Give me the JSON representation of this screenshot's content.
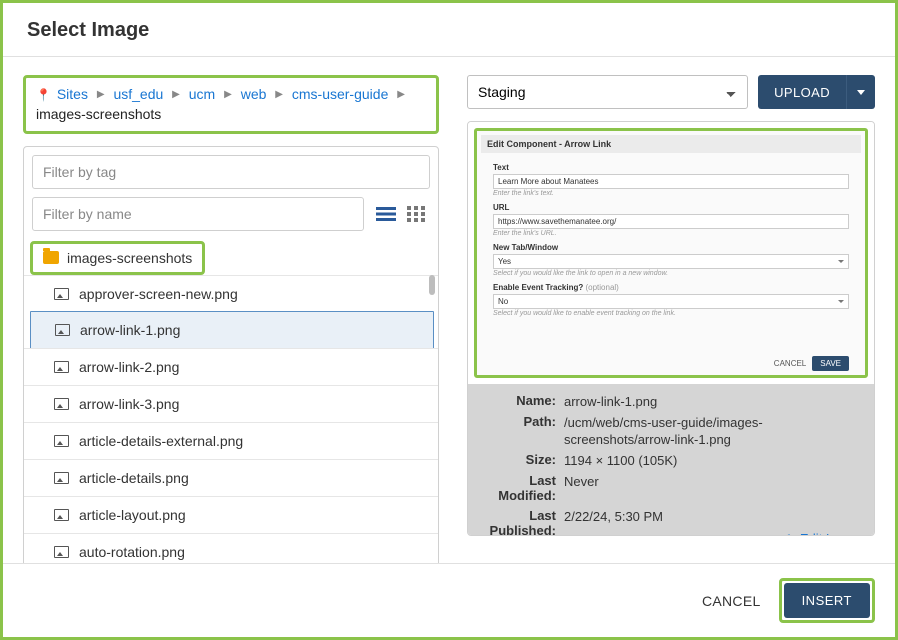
{
  "dialog": {
    "title": "Select Image"
  },
  "breadcrumb": {
    "parts": [
      "Sites",
      "usf_edu",
      "ucm",
      "web",
      "cms-user-guide"
    ],
    "current": "images-screenshots"
  },
  "filters": {
    "tag_placeholder": "Filter by tag",
    "name_placeholder": "Filter by name"
  },
  "tree": {
    "folder_label": "images-screenshots"
  },
  "files": [
    {
      "name": "approver-screen-new.png",
      "selected": false
    },
    {
      "name": "arrow-link-1.png",
      "selected": true
    },
    {
      "name": "arrow-link-2.png",
      "selected": false
    },
    {
      "name": "arrow-link-3.png",
      "selected": false
    },
    {
      "name": "article-details-external.png",
      "selected": false
    },
    {
      "name": "article-details.png",
      "selected": false
    },
    {
      "name": "article-layout.png",
      "selected": false
    },
    {
      "name": "auto-rotation.png",
      "selected": false
    }
  ],
  "env": {
    "selected": "Staging"
  },
  "upload": {
    "label": "UPLOAD"
  },
  "preview_component": {
    "title": "Edit Component - Arrow Link",
    "text_label": "Text",
    "text_value": "Learn More about Manatees",
    "text_help": "Enter the link's text.",
    "url_label": "URL",
    "url_value": "https://www.savethemanatee.org/",
    "url_help": "Enter the link's URL.",
    "newtab_label": "New Tab/Window",
    "newtab_value": "Yes",
    "newtab_help": "Select if you would like the link to open in a new window.",
    "event_label": "Enable Event Tracking?",
    "event_optional": "(optional)",
    "event_value": "No",
    "event_help": "Select if you would like to enable event tracking on the link.",
    "cancel": "CANCEL",
    "save": "SAVE"
  },
  "meta": {
    "name_label": "Name:",
    "name": "arrow-link-1.png",
    "path_label": "Path:",
    "path": "/ucm/web/cms-user-guide/images-screenshots/arrow-link-1.png",
    "size_label": "Size:",
    "size": "1194 × 1100 (105K)",
    "modified_label": "Last Modified:",
    "modified": "Never",
    "published_label": "Last Published:",
    "published": "2/22/24, 5:30 PM",
    "edit_link": "Edit Image"
  },
  "footer": {
    "cancel": "CANCEL",
    "insert": "INSERT"
  },
  "colors": {
    "highlight": "#8bc34a",
    "primary": "#2c4c6e",
    "link": "#1976d2"
  }
}
